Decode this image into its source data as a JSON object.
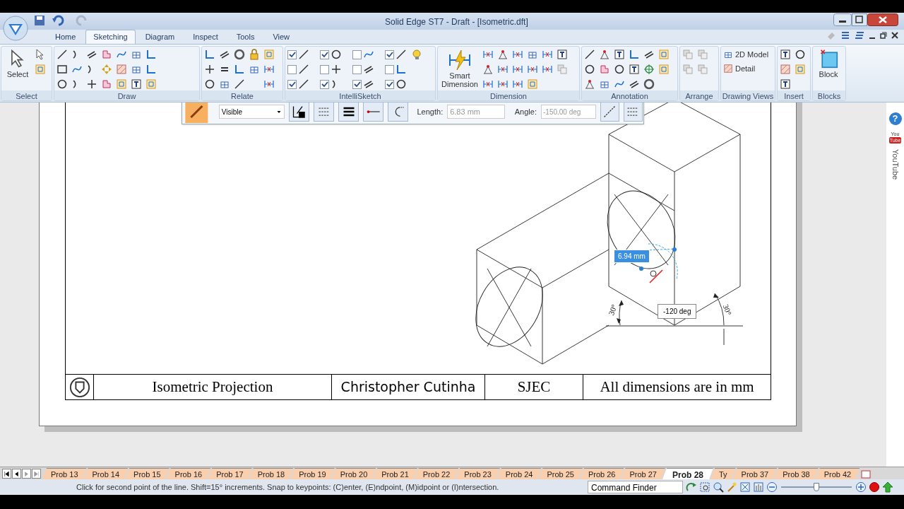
{
  "window": {
    "title": "Solid Edge ST7 - Draft - [Isometric.dft]"
  },
  "ribbon_tabs": [
    {
      "label": "Home",
      "selected": false
    },
    {
      "label": "Sketching",
      "selected": true
    },
    {
      "label": "Diagram",
      "selected": false
    },
    {
      "label": "Inspect",
      "selected": false
    },
    {
      "label": "Tools",
      "selected": false
    },
    {
      "label": "View",
      "selected": false
    }
  ],
  "ribbon": {
    "select_group": {
      "label": "Select",
      "button": "Select"
    },
    "draw_group": {
      "label": "Draw"
    },
    "relate_group": {
      "label": "Relate"
    },
    "intellisketch_group": {
      "label": "IntelliSketch",
      "options": [
        {
          "checked": true
        },
        {
          "checked": true
        },
        {
          "checked": false
        },
        {
          "checked": true
        },
        {
          "checked": false
        },
        {
          "checked": false
        },
        {
          "checked": false
        },
        {
          "checked": false
        },
        {
          "checked": true
        },
        {
          "checked": true
        },
        {
          "checked": true
        },
        {
          "checked": true
        }
      ]
    },
    "dimension_group": {
      "label": "Dimension",
      "button_lines": [
        "Smart",
        "Dimension"
      ]
    },
    "annotation_group": {
      "label": "Annotation"
    },
    "arrange_group": {
      "label": "Arrange"
    },
    "drawing_views_group": {
      "label": "Drawing Views",
      "buttons": [
        "2D Model",
        "Detail"
      ]
    },
    "insert_group": {
      "label": "Insert"
    },
    "blocks_group": {
      "label": "Blocks",
      "button": "Block"
    }
  },
  "command_bar": {
    "line_style": "Visible",
    "length_label": "Length:",
    "length": "6.83 mm",
    "angle_label": "Angle:",
    "angle": "-150.00 deg"
  },
  "drawing": {
    "length_dimension": "6.94 mm",
    "angle_dimension": "-120 deg",
    "angle_notes": [
      "30°",
      "30°"
    ]
  },
  "title_block": {
    "title": "Isometric Projection",
    "author": "Christopher Cutinha",
    "institution": "SJEC",
    "note": "All dimensions are in mm"
  },
  "side_panel": {
    "help": "?",
    "youtube_logo": [
      "You",
      "Tube"
    ],
    "youtube_label": "YouTube"
  },
  "sheet_tabs": [
    {
      "label": "Prob 13",
      "selected": false
    },
    {
      "label": "Prob 14",
      "selected": false
    },
    {
      "label": "Prob 15",
      "selected": false
    },
    {
      "label": "Prob 16",
      "selected": false
    },
    {
      "label": "Prob 17",
      "selected": false
    },
    {
      "label": "Prob 18",
      "selected": false
    },
    {
      "label": "Prob 19",
      "selected": false
    },
    {
      "label": "Prob 20",
      "selected": false
    },
    {
      "label": "Prob 21",
      "selected": false
    },
    {
      "label": "Prob 22",
      "selected": false
    },
    {
      "label": "Prob 23",
      "selected": false
    },
    {
      "label": "Prob 24",
      "selected": false
    },
    {
      "label": "Prob 25",
      "selected": false
    },
    {
      "label": "Prob 26",
      "selected": false
    },
    {
      "label": "Prob 27",
      "selected": false
    },
    {
      "label": "Prob 28",
      "selected": true
    },
    {
      "label": "Ty",
      "selected": false
    },
    {
      "label": "Prob 37",
      "selected": false
    },
    {
      "label": "Prob 38",
      "selected": false
    },
    {
      "label": "Prob 42",
      "selected": false
    }
  ],
  "status_bar": {
    "prompt": "Click for second point of the line. Shift=15° increments.  Snap to keypoints: (C)enter, (E)ndpoint, (M)idpoint or (I)ntersection.",
    "command_finder": "Command Finder",
    "zoom": {
      "level": 0.5
    }
  }
}
